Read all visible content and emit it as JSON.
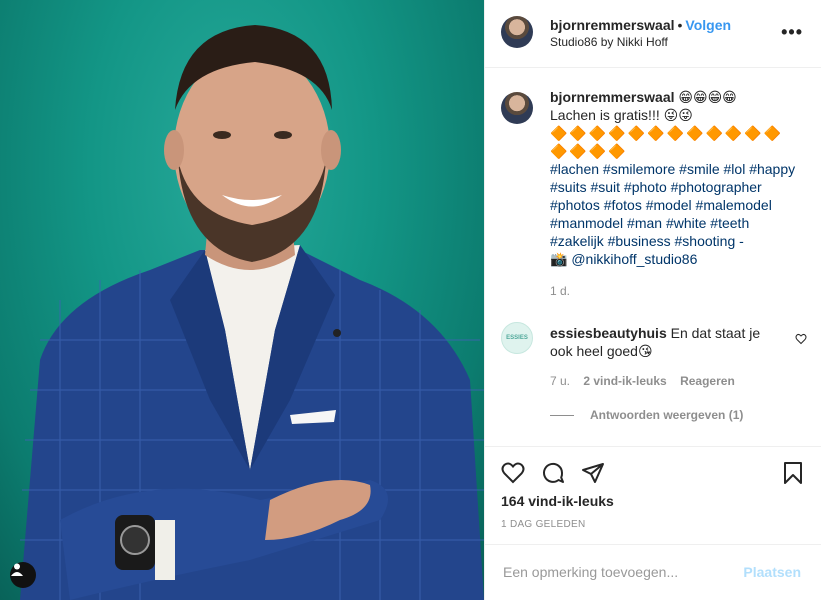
{
  "post": {
    "author": {
      "username": "bjornremmerswaal",
      "dot": "•",
      "follow_label": "Volgen",
      "location": "Studio86 by Nikki Hoff"
    },
    "more_label": "•••",
    "caption": {
      "username": "bjornremmerswaal",
      "emojis": "😁😁😁😁",
      "line1": "Lachen is gratis!!! 😜😜",
      "diamonds_row1": "🔶🔶🔶🔶🔶🔶🔶🔶🔶🔶🔶🔶",
      "diamonds_row2": "🔶🔶🔶🔶",
      "hashtags": "#lachen #smilemore #smile #lol #happy #suits #suit #photo #photographer #photos #fotos #model #malemodel #manmodel #man #white #teeth #zakelijk #business #shooting -",
      "photo_credit": "📸 @nikkihoff_studio86",
      "age": "1 d."
    },
    "comment": {
      "avatar_text": "ESSIES",
      "username": "essiesbeautyhuis",
      "text": "En dat staat je ook heel goed😘",
      "age": "7 u.",
      "likes": "2 vind-ik-leuks",
      "reply_label": "Reageren",
      "view_replies": "Antwoorden weergeven (1)"
    },
    "likes_count": "164 vind-ik-leuks",
    "timestamp": "1 DAG GELEDEN",
    "add_comment": {
      "placeholder": "Een opmerking toevoegen...",
      "post_label": "Plaatsen"
    }
  },
  "icons": {
    "like": "heart-icon",
    "comment": "comment-bubble-icon",
    "share": "paper-plane-icon",
    "save": "bookmark-icon",
    "tag": "user-tag-icon"
  }
}
